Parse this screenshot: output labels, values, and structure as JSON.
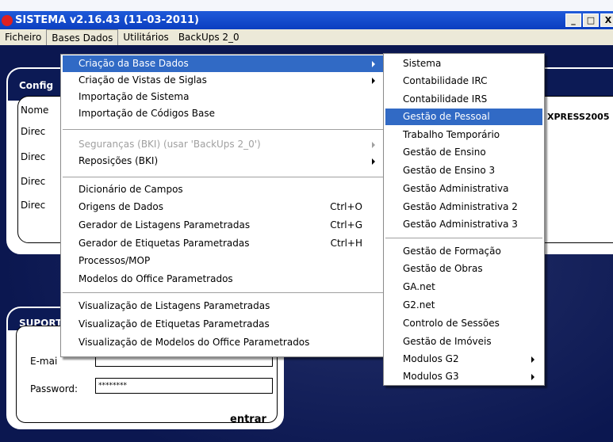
{
  "window": {
    "title": "SISTEMA v2.16.43 (11-03-2011)",
    "minimize": "_",
    "maximize": "□",
    "close": "X"
  },
  "menubar": [
    "Ficheiro",
    "Bases Dados",
    "Utilitários",
    "BackUps 2_0"
  ],
  "config": {
    "title": "Config",
    "labels": [
      "Nome",
      "Direc",
      "Direc",
      "Direc",
      "Direc"
    ],
    "value_right": "XPRESS2005"
  },
  "support": {
    "title": "SUPORT",
    "email_label": "E-mai",
    "password_label": "Password:",
    "password_value": "********",
    "enter_label": "entrar"
  },
  "menu_bases": {
    "items": [
      {
        "label": "Criação da Base Dados",
        "submenu": true,
        "selected": true
      },
      {
        "label": "Criação de Vistas de Siglas",
        "submenu": true
      },
      {
        "label": "Importação de Sistema"
      },
      {
        "label": "Importação de Códigos Base"
      },
      {
        "label": "Seguranças (BKI) (usar 'BackUps 2_0')",
        "submenu": true,
        "disabled": true
      },
      {
        "label": "Reposições (BKI)",
        "submenu": true
      },
      {
        "label": "Dicionário de Campos"
      },
      {
        "label": "Origens de Dados",
        "shortcut": "Ctrl+O"
      },
      {
        "label": "Gerador de Listagens Parametradas",
        "shortcut": "Ctrl+G"
      },
      {
        "label": "Gerador de Etiquetas Parametradas",
        "shortcut": "Ctrl+H"
      },
      {
        "label": "Processos/MOP"
      },
      {
        "label": "Modelos do Office Parametrados"
      },
      {
        "label": "Visualização de Listagens Parametradas"
      },
      {
        "label": "Visualização de Etiquetas Parametradas"
      },
      {
        "label": "Visualização de Modelos do Office Parametrados"
      }
    ]
  },
  "menu_criacao": {
    "items": [
      {
        "label": "Sistema"
      },
      {
        "label": "Contabilidade IRC"
      },
      {
        "label": "Contabilidade IRS"
      },
      {
        "label": "Gestão de Pessoal",
        "selected": true
      },
      {
        "label": "Trabalho Temporário"
      },
      {
        "label": "Gestão de Ensino"
      },
      {
        "label": "Gestão de Ensino 3"
      },
      {
        "label": "Gestão Administrativa"
      },
      {
        "label": "Gestão Administrativa 2"
      },
      {
        "label": "Gestão Administrativa 3"
      },
      {
        "label": "Gestão de Formação"
      },
      {
        "label": "Gestão de Obras"
      },
      {
        "label": "GA.net"
      },
      {
        "label": "G2.net"
      },
      {
        "label": "Controlo de Sessões"
      },
      {
        "label": "Gestão de Imóveis"
      },
      {
        "label": "Modulos G2",
        "submenu": true
      },
      {
        "label": "Modulos G3",
        "submenu": true
      }
    ]
  }
}
